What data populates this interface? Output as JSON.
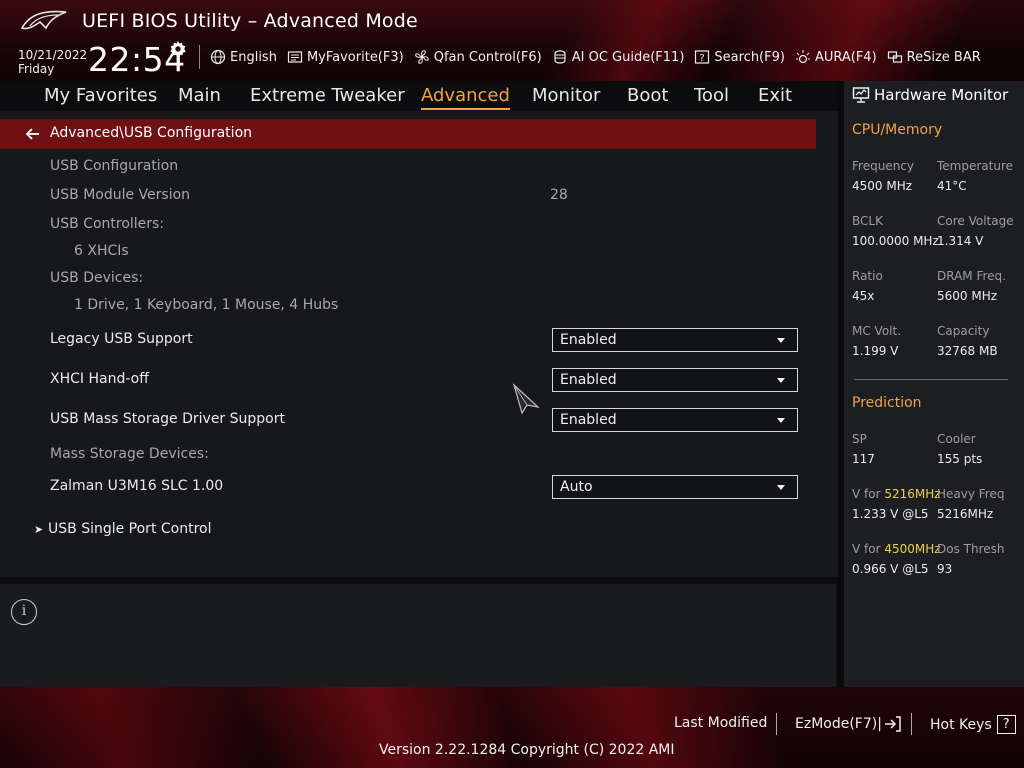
{
  "header": {
    "title": "UEFI BIOS Utility – Advanced Mode",
    "date": "10/21/2022",
    "day": "Friday",
    "time": "22:54",
    "toolbar": [
      {
        "label": "English",
        "icon": "globe-icon"
      },
      {
        "label": "MyFavorite(F3)",
        "icon": "favorite-list-icon"
      },
      {
        "label": "Qfan Control(F6)",
        "icon": "fan-icon"
      },
      {
        "label": "AI OC Guide(F11)",
        "icon": "ai-chip-icon"
      },
      {
        "label": "Search(F9)",
        "icon": "search-question-icon"
      },
      {
        "label": "AURA(F4)",
        "icon": "aura-light-icon"
      },
      {
        "label": "ReSize BAR",
        "icon": "resize-bar-icon"
      }
    ]
  },
  "menu": {
    "items": [
      "My Favorites",
      "Main",
      "Extreme Tweaker",
      "Advanced",
      "Monitor",
      "Boot",
      "Tool",
      "Exit"
    ],
    "active": "Advanced"
  },
  "main": {
    "breadcrumb": "Advanced\\USB Configuration",
    "usb_configuration_label": "USB Configuration",
    "usb_module_version_label": "USB Module Version",
    "usb_module_version_value": "28",
    "usb_controllers_label": "USB Controllers:",
    "usb_controllers_value": "6 XHCIs",
    "usb_devices_label": "USB Devices:",
    "usb_devices_value": "1 Drive, 1 Keyboard, 1 Mouse, 4 Hubs",
    "legacy_usb_label": "Legacy USB Support",
    "legacy_usb_value": "Enabled",
    "xhci_handoff_label": "XHCI Hand-off",
    "xhci_handoff_value": "Enabled",
    "mass_storage_driver_label": "USB Mass Storage Driver Support",
    "mass_storage_driver_value": "Enabled",
    "mass_storage_devices_label": "Mass Storage Devices:",
    "zalman_label": "Zalman U3M16 SLC 1.00",
    "zalman_value": "Auto",
    "single_port_control_label": "USB Single Port Control"
  },
  "hardware_monitor": {
    "title": "Hardware Monitor",
    "cpu_memory_title": "CPU/Memory",
    "frequency_label": "Frequency",
    "frequency_value": "4500 MHz",
    "temperature_label": "Temperature",
    "temperature_value": "41°C",
    "bclk_label": "BCLK",
    "bclk_value": "100.0000 MHz",
    "core_voltage_label": "Core Voltage",
    "core_voltage_value": "1.314 V",
    "ratio_label": "Ratio",
    "ratio_value": "45x",
    "dram_freq_label": "DRAM Freq.",
    "dram_freq_value": "5600 MHz",
    "mc_volt_label": "MC Volt.",
    "mc_volt_value": "1.199 V",
    "capacity_label": "Capacity",
    "capacity_value": "32768 MB",
    "prediction_title": "Prediction",
    "sp_label": "SP",
    "sp_value": "117",
    "cooler_label": "Cooler",
    "cooler_value": "155 pts",
    "v_for_prefix_1": "V for ",
    "v_for_freq_1": "5216MHz",
    "v_for_value_1": "1.233 V @L5",
    "heavy_freq_label": "Heavy Freq",
    "heavy_freq_value": "5216MHz",
    "v_for_prefix_2": "V for ",
    "v_for_freq_2": "4500MHz",
    "v_for_value_2": "0.966 V @L5",
    "dos_thresh_label": "Dos Thresh",
    "dos_thresh_value": "93"
  },
  "footer": {
    "last_modified": "Last Modified",
    "ezmode": "EzMode(F7)|",
    "hot_keys": "Hot Keys",
    "hot_keys_glyph": "?",
    "version": "Version 2.22.1284 Copyright (C) 2022 AMI"
  },
  "colors": {
    "accent": "#f0a24a",
    "breadcrumb_bg": "#6e1014",
    "highlight_yellow": "#e8d24a"
  }
}
